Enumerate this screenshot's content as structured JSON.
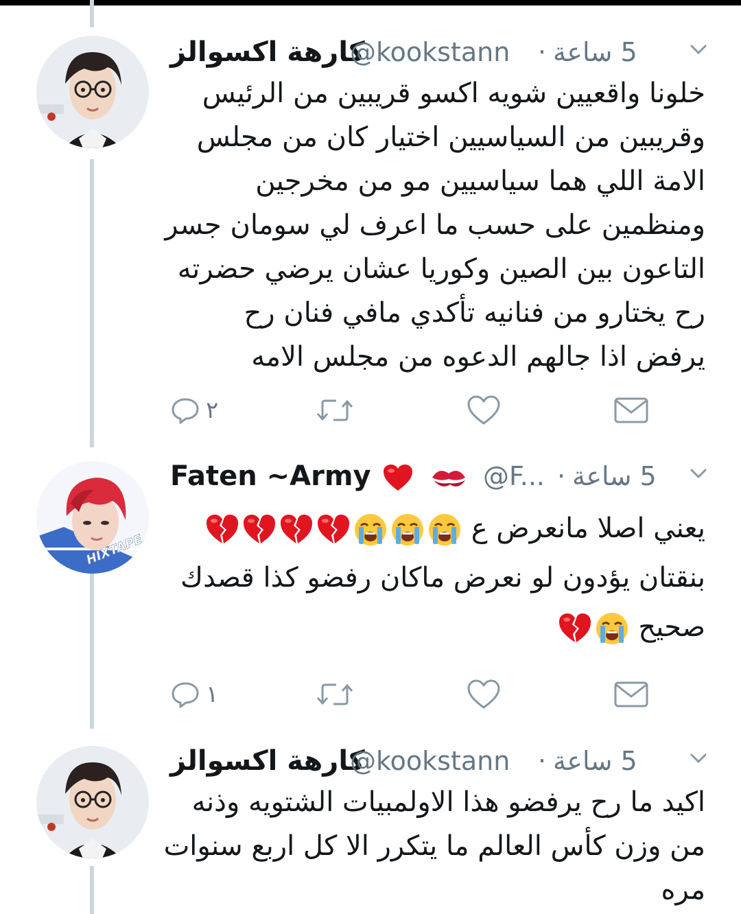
{
  "tweets": [
    {
      "display_name": "كارهة اكسوالز",
      "handle": "@kookstann",
      "time": "5 ساعة",
      "lines": [
        "خلونا واقعيين شويه اكسو قريبين من الرئيس",
        "وقريبين من السياسيين اختيار كان من مجلس",
        "الامة اللي هما سياسيين مو من مخرجين",
        "ومنظمين على حسب ما اعرف لي سومان جسر",
        "التاعون بين الصين وكوريا عشان يرضي حضرته",
        "رح يختارو من فنانيه تأكدي مافي فنان رح",
        "يرفض اذا جالهم الدعوه من مجلس الامه"
      ],
      "reply_count": "٢",
      "avatar_icon": "avatar-boy-glasses"
    },
    {
      "display_name": "Faten ~Army",
      "name_emojis": [
        "red-heart",
        "kiss-mark"
      ],
      "handle": "@F...",
      "time": "5 ساعة",
      "line1_text": "يعني اصلا مانعرض ع",
      "line1_emojis": [
        "crying-face",
        "crying-face",
        "crying-face",
        "broken-heart",
        "broken-heart",
        "broken-heart",
        "broken-heart"
      ],
      "line2_text": "بنقتان يؤدون لو نعرض ماكان رفضو كذا قصدك",
      "line3_text": "صحيح",
      "line3_emojis": [
        "crying-face",
        "broken-heart"
      ],
      "reply_count": "١",
      "avatar_icon": "avatar-red-hair",
      "avatar_watermark": "HIXTAPE"
    },
    {
      "display_name": "كارهة اكسوالز",
      "handle": "@kookstann",
      "time": "5 ساعة",
      "lines": [
        "اكيد ما رح يرفضو هذا الاولمبيات الشتويه وذنه",
        "من وزن كأس العالم ما يتكرر الا كل اربع سنوات",
        "مره"
      ],
      "avatar_icon": "avatar-boy-glasses"
    }
  ],
  "icons": {
    "reply": "reply-icon",
    "retweet": "retweet-icon",
    "like": "heart-icon",
    "dm": "envelope-icon",
    "menu": "chevron-down-icon"
  },
  "colors": {
    "text": "#14171a",
    "muted": "#657786",
    "thread_line": "#ccd6dd",
    "top_bar": "#000000"
  }
}
